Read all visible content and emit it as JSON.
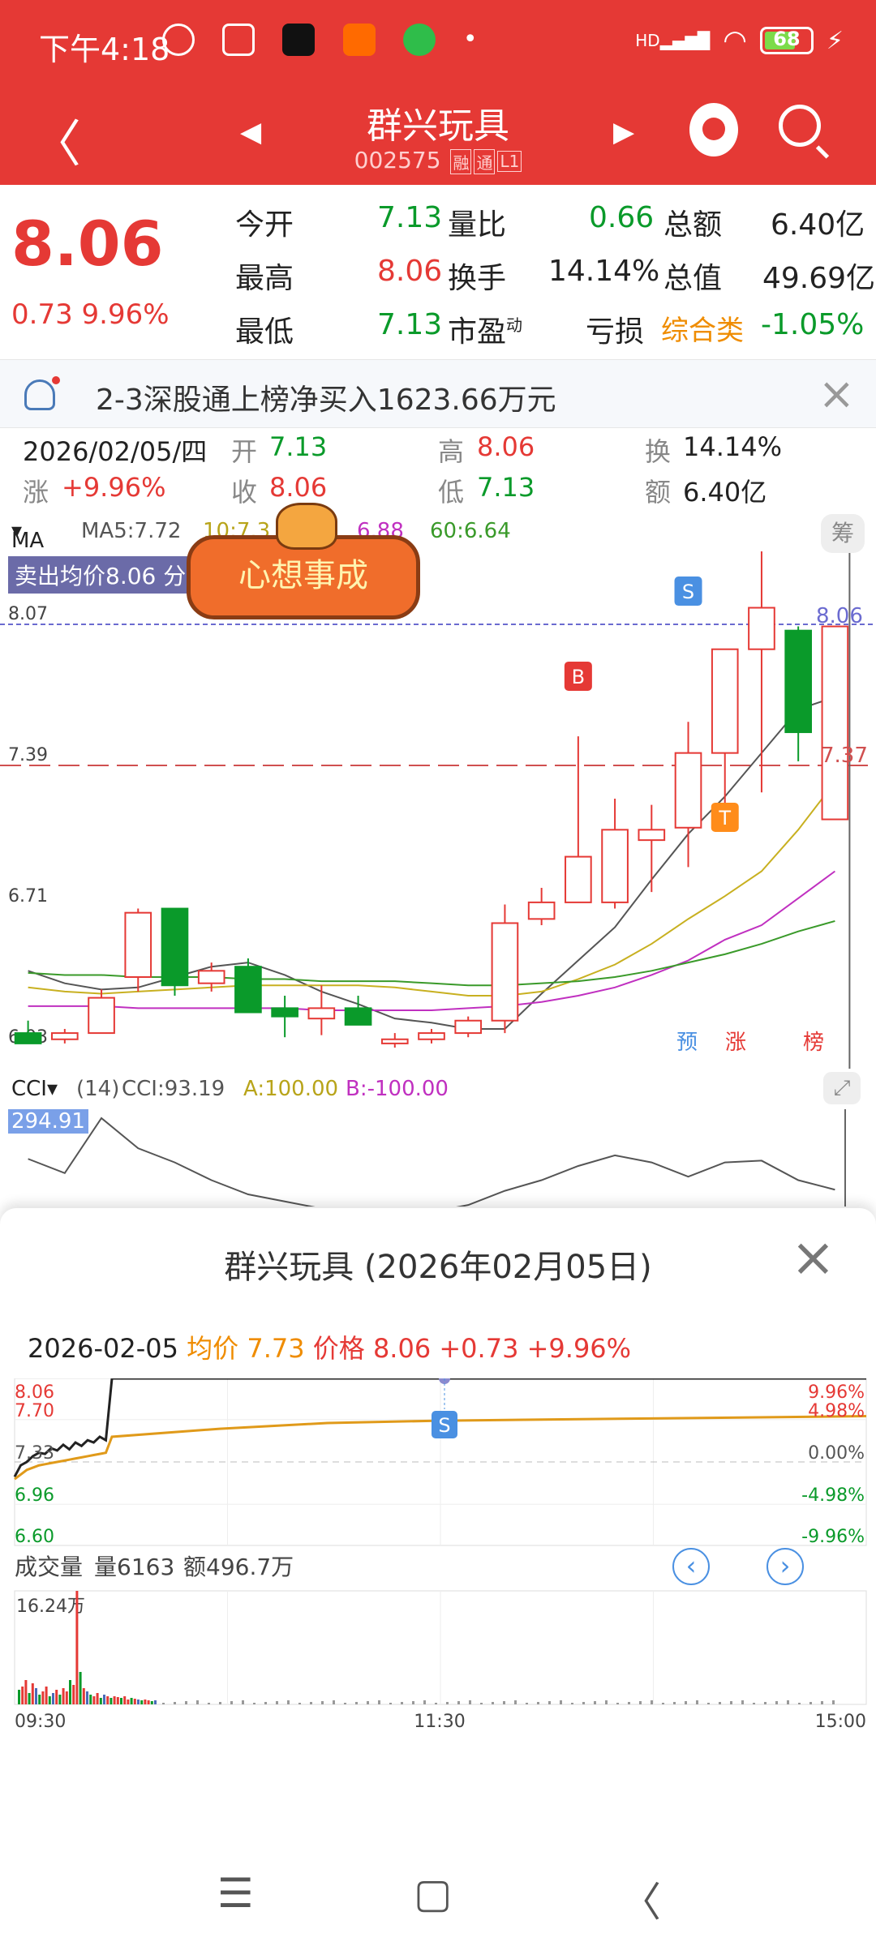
{
  "status_bar": {
    "time": "下午4:18",
    "signal": "HD",
    "battery": "68"
  },
  "nav": {
    "title": "群兴玩具",
    "code": "002575",
    "tags": [
      "融",
      "通",
      "L1"
    ]
  },
  "quote": {
    "price": "8.06",
    "change": "0.73",
    "change_pct": "9.96%",
    "rows": [
      {
        "l1": "今开",
        "v1": "7.13",
        "l2": "量比",
        "v2": "0.66",
        "l3": "总额",
        "v3": "6.40亿"
      },
      {
        "l1": "最高",
        "v1": "8.06",
        "l2": "换手",
        "v2": "14.14%",
        "l3": "总值",
        "v3": "49.69亿"
      },
      {
        "l1": "最低",
        "v1": "7.13",
        "l2": "市盈",
        "v2sup": "动",
        "v2": "亏损",
        "l3": "综合类",
        "v3": "-1.05%"
      }
    ]
  },
  "notice": {
    "text": "2-3深股通上榜净买入1623.66万元"
  },
  "day_info": {
    "date": "2026/02/05/四",
    "open_label": "开",
    "open": "7.13",
    "high_label": "高",
    "high": "8.06",
    "turnover_label": "换",
    "turnover": "14.14%",
    "chg_label": "涨",
    "chg": "+9.96%",
    "close_label": "收",
    "close": "8.06",
    "low_label": "低",
    "low": "7.13",
    "amount_label": "额",
    "amount": "6.40亿"
  },
  "ma_bar": {
    "selector": "MA",
    "ma5": "MA5:7.72",
    "ma10": "10:7.3",
    "ma20": "6.88",
    "ma60": "60:6.64",
    "chip_button": "筹"
  },
  "sell_avg": "卖出均价8.06 分",
  "badge_text": "心想事成",
  "kline": {
    "price_labels": [
      "8.07",
      "7.39",
      "6.71",
      "6.03"
    ],
    "right_labels": [
      "8.06",
      "7.37"
    ],
    "signals": [
      "B",
      "S",
      "S",
      "T"
    ],
    "bottom_tags": [
      "预",
      "涨",
      "榜"
    ]
  },
  "cci": {
    "selector": "CCI",
    "param": "(14)",
    "cci": "CCI:93.19",
    "a": "A:100.00",
    "b": "B:-100.00",
    "top_value": "294.91"
  },
  "sheet": {
    "title": "群兴玩具 (2026年02月05日)",
    "date": "2026-02-05",
    "avg_label": "均价",
    "avg": "7.73",
    "price_label": "价格",
    "price": "8.06",
    "change": "+0.73",
    "change_pct": "+9.96%",
    "left_labels": [
      "8.06",
      "7.70",
      "7.33",
      "6.96",
      "6.60"
    ],
    "right_labels": [
      "9.96%",
      "4.98%",
      "0.00%",
      "-4.98%",
      "-9.96%"
    ],
    "signal": "S",
    "volume_label": "成交量",
    "volume": "量6163",
    "amount": "额496.7万",
    "vol_max": "16.24万",
    "time_labels": [
      "09:30",
      "11:30",
      "15:00"
    ]
  },
  "chart_data": [
    {
      "type": "candlestick",
      "title": "",
      "ylim": [
        6.03,
        8.07
      ],
      "candles": [
        {
          "o": 6.1,
          "h": 6.16,
          "l": 6.06,
          "c": 6.05
        },
        {
          "o": 6.07,
          "h": 6.12,
          "l": 6.05,
          "c": 6.1
        },
        {
          "o": 6.1,
          "h": 6.31,
          "l": 6.1,
          "c": 6.27
        },
        {
          "o": 6.37,
          "h": 6.7,
          "l": 6.3,
          "c": 6.68
        },
        {
          "o": 6.7,
          "h": 6.7,
          "l": 6.28,
          "c": 6.33
        },
        {
          "o": 6.34,
          "h": 6.44,
          "l": 6.3,
          "c": 6.4
        },
        {
          "o": 6.42,
          "h": 6.46,
          "l": 6.2,
          "c": 6.2
        },
        {
          "o": 6.22,
          "h": 6.28,
          "l": 6.08,
          "c": 6.18
        },
        {
          "o": 6.17,
          "h": 6.33,
          "l": 6.09,
          "c": 6.22
        },
        {
          "o": 6.22,
          "h": 6.28,
          "l": 6.14,
          "c": 6.14
        },
        {
          "o": 6.05,
          "h": 6.1,
          "l": 6.03,
          "c": 6.07
        },
        {
          "o": 6.07,
          "h": 6.12,
          "l": 6.05,
          "c": 6.1
        },
        {
          "o": 6.1,
          "h": 6.18,
          "l": 6.08,
          "c": 6.16
        },
        {
          "o": 6.16,
          "h": 6.72,
          "l": 6.1,
          "c": 6.63
        },
        {
          "o": 6.65,
          "h": 6.8,
          "l": 6.62,
          "c": 6.73
        },
        {
          "o": 6.73,
          "h": 7.53,
          "l": 6.73,
          "c": 6.95
        },
        {
          "o": 6.73,
          "h": 7.23,
          "l": 6.7,
          "c": 7.08
        },
        {
          "o": 7.03,
          "h": 7.2,
          "l": 6.78,
          "c": 7.08
        },
        {
          "o": 7.09,
          "h": 7.6,
          "l": 6.9,
          "c": 7.45
        },
        {
          "o": 7.45,
          "h": 7.95,
          "l": 7.18,
          "c": 7.95
        },
        {
          "o": 7.95,
          "h": 8.58,
          "l": 7.26,
          "c": 8.15
        },
        {
          "o": 8.04,
          "h": 8.06,
          "l": 7.41,
          "c": 7.55
        },
        {
          "o": 7.13,
          "h": 8.06,
          "l": 7.13,
          "c": 8.06
        }
      ],
      "ma5": [
        6.4,
        6.34,
        6.31,
        6.32,
        6.37,
        6.42,
        6.44,
        6.38,
        6.3,
        6.24,
        6.17,
        6.15,
        6.12,
        6.12,
        6.29,
        6.45,
        6.61,
        6.84,
        7.06,
        7.24,
        7.45,
        7.66,
        7.72
      ],
      "ma10": [
        6.32,
        6.3,
        6.29,
        6.3,
        6.31,
        6.32,
        6.33,
        6.33,
        6.33,
        6.33,
        6.32,
        6.3,
        6.28,
        6.28,
        6.3,
        6.36,
        6.43,
        6.53,
        6.65,
        6.76,
        6.88,
        7.08,
        7.31
      ],
      "ma20": [
        6.23,
        6.23,
        6.23,
        6.22,
        6.22,
        6.22,
        6.22,
        6.22,
        6.21,
        6.21,
        6.21,
        6.21,
        6.22,
        6.23,
        6.25,
        6.28,
        6.32,
        6.38,
        6.45,
        6.55,
        6.62,
        6.75,
        6.88
      ],
      "ma60": [
        6.39,
        6.38,
        6.38,
        6.37,
        6.37,
        6.37,
        6.36,
        6.36,
        6.35,
        6.35,
        6.35,
        6.34,
        6.33,
        6.33,
        6.34,
        6.35,
        6.37,
        6.4,
        6.44,
        6.48,
        6.53,
        6.59,
        6.64
      ]
    },
    {
      "type": "line",
      "title": "",
      "series": [
        {
          "name": "CCI",
          "values": [
            180,
            140,
            294.91,
            210,
            170,
            120,
            80,
            60,
            40,
            30,
            20,
            30,
            50,
            90,
            120,
            160,
            190,
            170,
            130,
            170,
            175,
            120,
            93.19
          ]
        }
      ]
    },
    {
      "type": "line",
      "title": "",
      "x": [
        "09:30",
        "11:30",
        "15:00"
      ],
      "ylim": [
        6.6,
        8.06
      ],
      "series": [
        {
          "name": "价格",
          "values": [
            7.2,
            7.3,
            7.33,
            7.38,
            7.41,
            7.4,
            7.45,
            7.43,
            7.48,
            7.44,
            7.5,
            7.47,
            7.52,
            7.5,
            7.55,
            7.52,
            8.06,
            8.06,
            8.06,
            8.06,
            8.06,
            8.06,
            8.06,
            8.06
          ]
        },
        {
          "name": "均价",
          "values": [
            7.18,
            7.22,
            7.26,
            7.28,
            7.3,
            7.31,
            7.32,
            7.33,
            7.34,
            7.35,
            7.36,
            7.37,
            7.38,
            7.39,
            7.4,
            7.41,
            7.55,
            7.62,
            7.67,
            7.69,
            7.7,
            7.71,
            7.72,
            7.73
          ]
        }
      ]
    }
  ]
}
